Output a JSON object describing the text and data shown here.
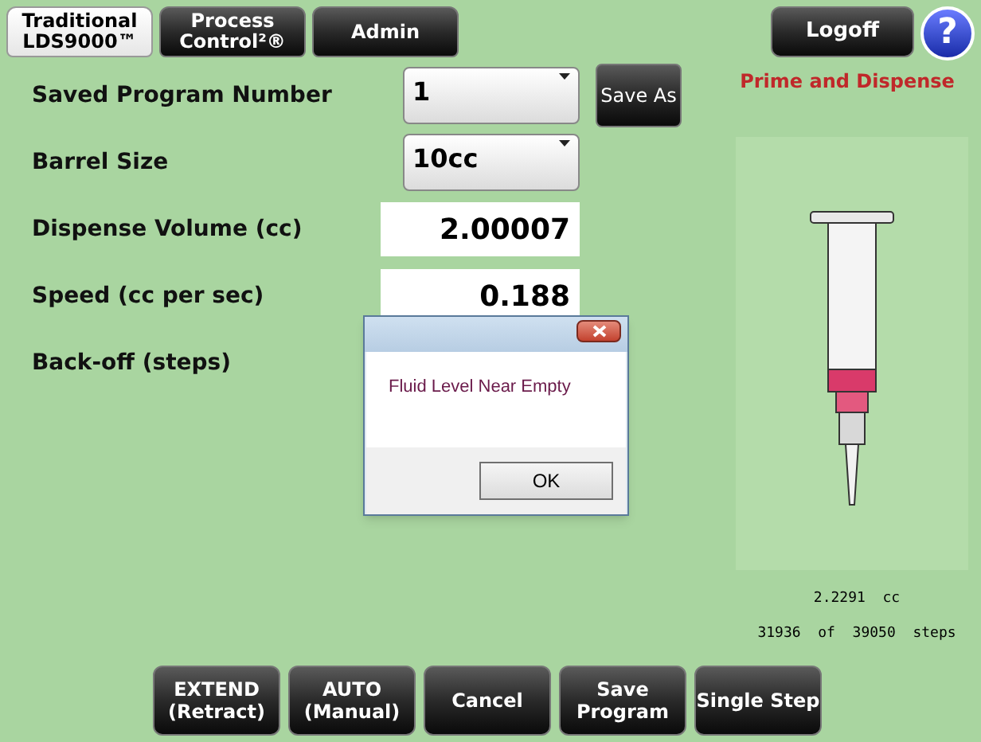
{
  "tabs": [
    {
      "label": "Traditional\nLDS9000™",
      "selected": true
    },
    {
      "label": "Process\nControl²®",
      "selected": false
    },
    {
      "label": "Admin",
      "selected": false
    }
  ],
  "logoff_button": "Logoff",
  "help_button": "?",
  "mode_title": "Prime and Dispense",
  "fields": [
    {
      "label": "Saved Program Number",
      "kind": "dropdown",
      "value": "1"
    },
    {
      "label": "Barrel Size",
      "kind": "dropdown",
      "value": "10cc"
    },
    {
      "label": "Dispense Volume (cc)",
      "kind": "input",
      "value": "2.00007"
    },
    {
      "label": "Speed (cc per sec)",
      "kind": "input",
      "value": "0.188"
    },
    {
      "label": "Back-off (steps)",
      "kind": "covered"
    }
  ],
  "save_as_button": "Save As",
  "syringe": {
    "volume": "2.2291  cc",
    "steps": "31936  of  39050  steps"
  },
  "buttons": [
    "EXTEND\n(Retract)",
    "AUTO\n(Manual)",
    "Cancel",
    "Save\nProgram",
    "Single Step"
  ],
  "dialog": {
    "message": "Fluid Level Near Empty",
    "ok_button": "OK"
  }
}
